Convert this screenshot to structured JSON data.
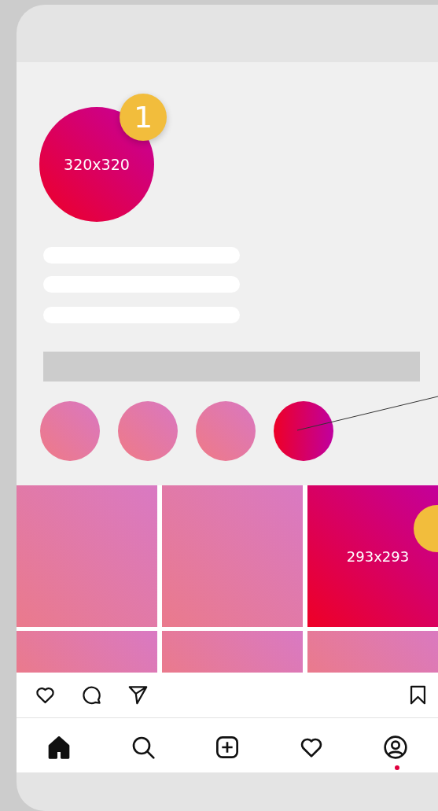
{
  "profile": {
    "picture_label": "320x320",
    "badge": "1"
  },
  "highlights": [
    {
      "selected": false
    },
    {
      "selected": false
    },
    {
      "selected": false
    },
    {
      "selected": true
    }
  ],
  "grid_rows": [
    [
      {
        "selected": false,
        "badge": false
      },
      {
        "selected": false,
        "badge": false
      },
      {
        "selected": true,
        "badge": true,
        "label": "293x293"
      }
    ],
    [
      {
        "selected": false,
        "badge": false
      },
      {
        "selected": false,
        "badge": false
      },
      {
        "selected": false,
        "badge": false
      }
    ]
  ],
  "post_actions": [
    {
      "kind": "like"
    },
    {
      "kind": "comment"
    },
    {
      "kind": "share"
    },
    {
      "kind": "save"
    }
  ],
  "nav": [
    {
      "kind": "home",
      "selected": true,
      "notification": false
    },
    {
      "kind": "search",
      "selected": false,
      "notification": false
    },
    {
      "kind": "add",
      "selected": false,
      "notification": false
    },
    {
      "kind": "heart",
      "selected": false,
      "notification": false
    },
    {
      "kind": "profile",
      "selected": false,
      "notification": true
    }
  ]
}
